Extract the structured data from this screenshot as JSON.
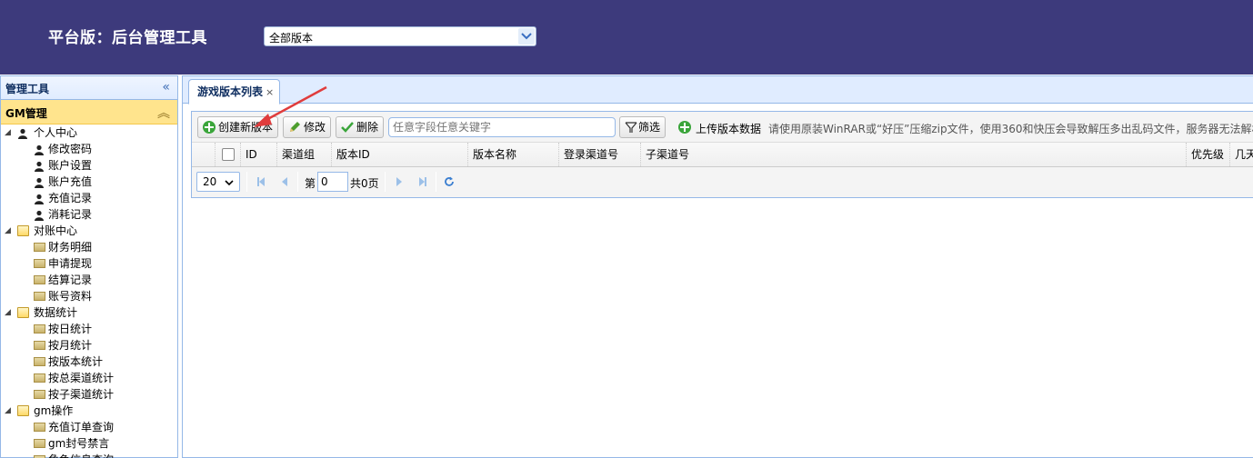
{
  "header": {
    "title": "平台版：后台管理工具",
    "version_select": "全部版本"
  },
  "sidebar": {
    "title": "管理工具",
    "section": "GM管理",
    "tree": [
      {
        "label": "个人中心",
        "children": [
          "修改密码",
          "账户设置",
          "账户充值",
          "充值记录",
          "消耗记录"
        ]
      },
      {
        "label": "对账中心",
        "children": [
          "财务明细",
          "申请提现",
          "结算记录",
          "账号资料"
        ]
      },
      {
        "label": "数据统计",
        "children": [
          "按日统计",
          "按月统计",
          "按版本统计",
          "按总渠道统计",
          "按子渠道统计"
        ]
      },
      {
        "label": "gm操作",
        "children": [
          "充值订单查询",
          "gm封号禁言",
          "角色信息查询"
        ]
      }
    ]
  },
  "tab": {
    "label": "游戏版本列表",
    "close": "×"
  },
  "toolbar": {
    "create": "创建新版本",
    "edit": "修改",
    "delete": "删除",
    "search_placeholder": "任意字段任意关键字",
    "filter": "筛选",
    "upload": "上传版本数据",
    "hint": "请使用原装WinRAR或“好压”压缩zip文件，使用360和快压会导致解压多出乱码文件，服务器无法解析"
  },
  "columns": [
    "ID",
    "渠道组",
    "版本ID",
    "版本名称",
    "登录渠道号",
    "子渠道号",
    "优先级",
    "几天"
  ],
  "pager": {
    "page_size": "20",
    "page_label": "第",
    "page_value": "0",
    "total": "共0页"
  }
}
